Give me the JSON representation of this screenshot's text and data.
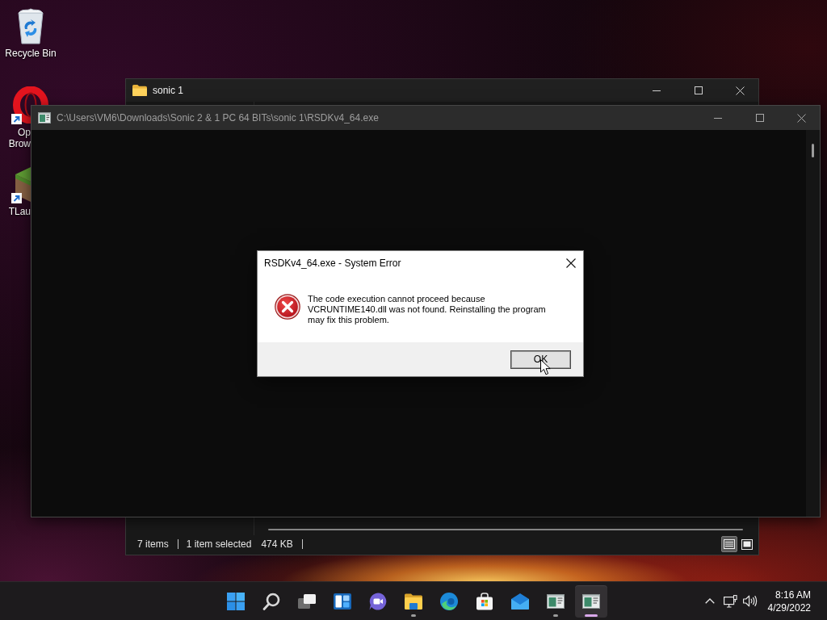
{
  "desktop": {
    "icons": [
      {
        "kind": "recycle-bin",
        "label_lines": [
          "Recycle Bin"
        ],
        "shortcut": false,
        "label_cut": false
      },
      {
        "kind": "ring-logo",
        "label_lines": [
          "Op",
          "Brow"
        ],
        "shortcut": true,
        "label_cut": true
      },
      {
        "kind": "grass-block",
        "label_lines": [
          "TLau"
        ],
        "shortcut": true,
        "label_cut": true
      }
    ]
  },
  "explorer_window": {
    "title": "sonic 1",
    "status_bar": {
      "items": "7 items",
      "selection": "1 item selected",
      "size": "474 KB"
    },
    "view_buttons": [
      {
        "kind": "details",
        "selected": true
      },
      {
        "kind": "large-icons",
        "selected": false
      }
    ]
  },
  "console_window": {
    "title": "C:\\Users\\VM6\\Downloads\\Sonic 2 & 1 PC 64 BITs\\sonic 1\\RSDKv4_64.exe"
  },
  "error_dialog": {
    "title": "RSDKv4_64.exe - System Error",
    "message": "The code execution cannot proceed because VCRUNTIME140.dll was not found. Reinstalling the program may fix this problem.",
    "buttons": [
      {
        "label": "OK",
        "default": true
      }
    ]
  },
  "taskbar": {
    "apps": [
      {
        "kind": "start",
        "running": false,
        "selected": false
      },
      {
        "kind": "search",
        "running": false,
        "selected": false
      },
      {
        "kind": "task-view",
        "running": false,
        "selected": false
      },
      {
        "kind": "widgets",
        "running": false,
        "selected": false
      },
      {
        "kind": "chat",
        "running": false,
        "selected": false
      },
      {
        "kind": "file-explorer",
        "running": true,
        "selected": false
      },
      {
        "kind": "edge",
        "running": false,
        "selected": false
      },
      {
        "kind": "store",
        "running": false,
        "selected": false
      },
      {
        "kind": "mail",
        "running": false,
        "selected": false
      },
      {
        "kind": "console",
        "running": true,
        "selected": false
      },
      {
        "kind": "console",
        "running": true,
        "selected": true
      }
    ],
    "tray": {
      "time": "8:16 AM",
      "date": "4/29/2022"
    }
  }
}
